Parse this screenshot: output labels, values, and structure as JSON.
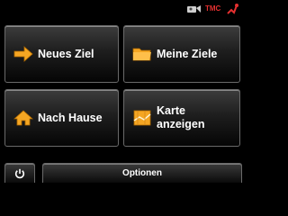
{
  "status": {
    "tmc_label": "TMC",
    "icons": [
      "gps-receiver-icon",
      "satellite-signal-icon"
    ]
  },
  "menu": {
    "neues_ziel": {
      "label": "Neues Ziel",
      "icon": "arrow-right-icon"
    },
    "meine_ziele": {
      "label": "Meine Ziele",
      "icon": "folder-icon"
    },
    "nach_hause": {
      "label": "Nach Hause",
      "icon": "home-icon"
    },
    "karte_anzeigen": {
      "label": "Karte\nanzeigen",
      "icon": "map-icon"
    }
  },
  "bottom_bar": {
    "power_icon": "power-icon",
    "options_label": "Optionen"
  },
  "colors": {
    "accent_orange": "#f5a623",
    "status_red": "#e53030",
    "background": "#000000"
  }
}
